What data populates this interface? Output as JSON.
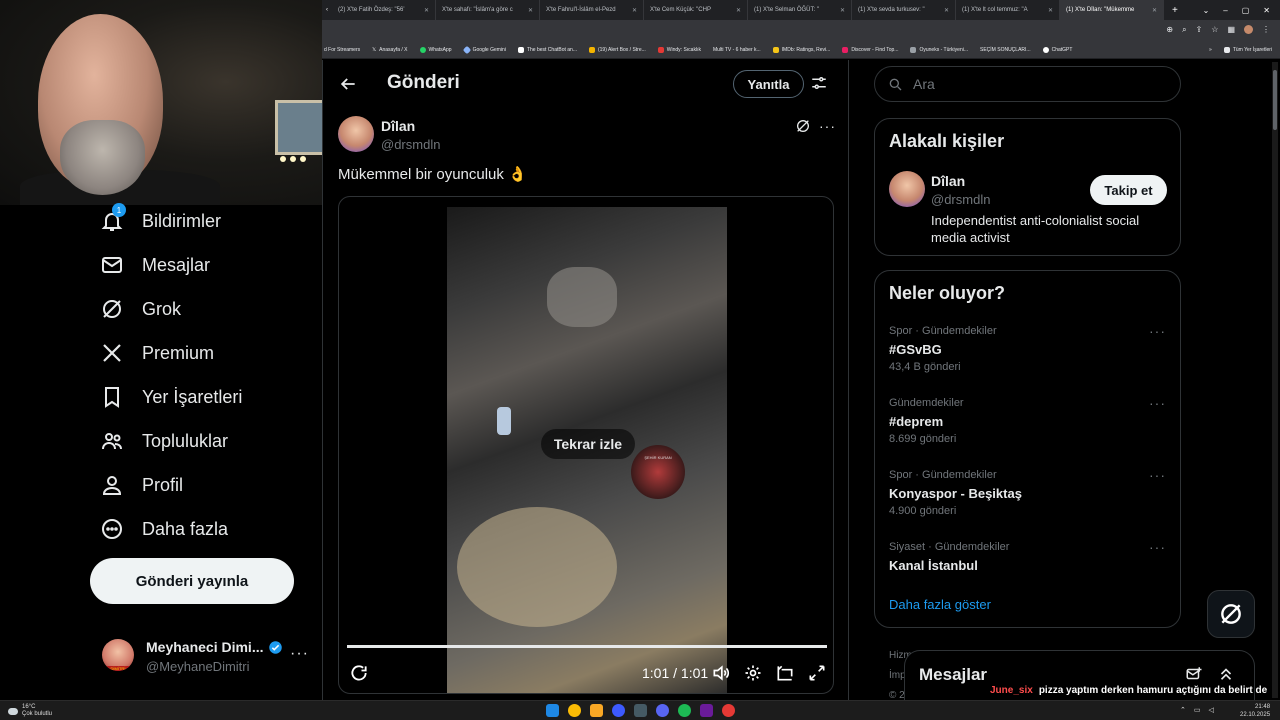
{
  "browser": {
    "tabs": [
      {
        "label": "(2) X'te Fatih Özdeş: \"56’",
        "active": false
      },
      {
        "label": "X'te sahafı: \"İslâm'a göre c",
        "active": false
      },
      {
        "label": "X'te Fahrul'l-İslâm el-Pezd",
        "active": false
      },
      {
        "label": "X'te Cem Küçük: \"CHP",
        "active": false
      },
      {
        "label": "(1) X'te Selman ÖĞÜT: \"",
        "active": false
      },
      {
        "label": "(1) X'te sevda turkusev: \"",
        "active": false
      },
      {
        "label": "(1) X'te lt col temmuz: \"A",
        "active": false
      },
      {
        "label": "(1) X'te Dîlan: \"Mükemme",
        "active": true
      }
    ],
    "new_tab": "+",
    "bookmarks": [
      "d For Streamers",
      "Anasayfa / X",
      "WhatsApp",
      "Google Gemini",
      "The best ChatBot an...",
      "(19) Alert Box / Stre...",
      "Windy: Sıcaklık",
      "Multi TV - 6 haber k...",
      "IMDb: Ratings, Revi...",
      "Discover - Find Top...",
      "Oyuneks - Türkiyeni...",
      "SEÇİM SONUÇLARI...",
      "ChatGPT"
    ],
    "bookmarks_more": "»",
    "all_bookmarks": "Tüm Yer İşaretleri"
  },
  "nav": {
    "items": [
      {
        "label": "Bildirimler",
        "icon": "bell-icon",
        "badge": "1"
      },
      {
        "label": "Mesajlar",
        "icon": "mail-icon"
      },
      {
        "label": "Grok",
        "icon": "grok-icon"
      },
      {
        "label": "Premium",
        "icon": "x-logo-icon"
      },
      {
        "label": "Yer İşaretleri",
        "icon": "bookmark-icon"
      },
      {
        "label": "Topluluklar",
        "icon": "communities-icon"
      },
      {
        "label": "Profil",
        "icon": "profile-icon"
      },
      {
        "label": "Daha fazla",
        "icon": "more-circle-icon"
      }
    ],
    "post_button": "Gönderi yayınla",
    "account": {
      "name": "Meyhaneci Dimi...",
      "handle": "@MeyhaneDimitri",
      "avatar_text": "DİMİTRİ"
    }
  },
  "main": {
    "header_title": "Gönderi",
    "reply_button": "Yanıtla",
    "post": {
      "author_name": "Dîlan",
      "author_handle": "@drsmdln",
      "text": "Mükemmel bir oyunculuk 👌",
      "video": {
        "replay_label": "Tekrar izle",
        "time": "1:01 / 1:01",
        "watermark": "ŞEHİR KURAN",
        "progress": 1.0
      }
    }
  },
  "sidebar": {
    "search_placeholder": "Ara",
    "related": {
      "title": "Alakalı kişiler",
      "name": "Dîlan",
      "handle": "@drsmdln",
      "follow_label": "Takip et",
      "bio": "Independentist anti-colonialist social media activist"
    },
    "trends": {
      "title": "Neler oluyor?",
      "items": [
        {
          "context": "Spor · Gündemdekiler",
          "name": "#GSvBG",
          "count": "43,4 B gönderi"
        },
        {
          "context": "Gündemdekiler",
          "name": "#deprem",
          "count": "8.699 gönderi"
        },
        {
          "context": "Spor · Gündemdekiler",
          "name": "Konyaspor - Beşiktaş",
          "count": "4.900 gönderi"
        },
        {
          "context": "Siyaset · Gündemdekiler",
          "name": "Kanal İstanbul",
          "count": ""
        }
      ],
      "show_more": "Daha fazla göster"
    },
    "footer_fragments": [
      "Hizm",
      "İmp",
      "© 2"
    ]
  },
  "messages_drawer": {
    "title": "Mesajlar"
  },
  "chat_overlay": {
    "user": "June_six",
    "message": "pizza yaptım derken hamuru açtığını da belirt de :)))"
  },
  "taskbar": {
    "weather_temp": "16°C",
    "weather_desc": "Çok bulutlu",
    "time": "21:48",
    "date": "22.10.2025"
  },
  "colors": {
    "accent": "#1d9bf0",
    "border": "#2f3336",
    "muted": "#71767b",
    "chat_user": "#ff4d4d"
  }
}
